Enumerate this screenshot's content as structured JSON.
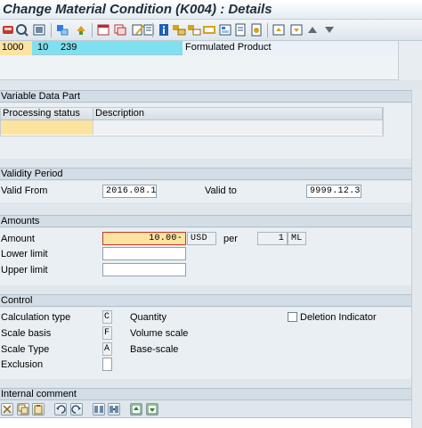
{
  "window": {
    "title": "Change Material Condition (K004) : Details"
  },
  "header_row": {
    "sales_org": "1000",
    "distribution_channel": "10",
    "material": "239",
    "material_description": "Formulated Product"
  },
  "variable_data_part": {
    "section_title": "Variable Data Part",
    "columns": [
      "Processing status",
      "Description"
    ],
    "rows": [
      {
        "processing_status": "",
        "description": ""
      }
    ]
  },
  "validity_period": {
    "section_title": "Validity Period",
    "valid_from_label": "Valid From",
    "valid_from": "2016.08.10",
    "valid_to_label": "Valid to",
    "valid_to": "9999.12.31"
  },
  "amounts": {
    "section_title": "Amounts",
    "amount_label": "Amount",
    "amount_value": "10.00-",
    "currency": "USD",
    "per_label": "per",
    "per_value": "1",
    "unit": "ML",
    "lower_limit_label": "Lower limit",
    "lower_limit_value": "",
    "upper_limit_label": "Upper limit",
    "upper_limit_value": ""
  },
  "control": {
    "section_title": "Control",
    "calculation_type_label": "Calculation type",
    "calculation_type_code": "C",
    "calculation_type_text": "Quantity",
    "scale_basis_label": "Scale basis",
    "scale_basis_code": "F",
    "scale_basis_text": "Volume scale",
    "scale_type_label": "Scale Type",
    "scale_type_code": "A",
    "scale_type_text": "Base-scale",
    "exclusion_label": "Exclusion",
    "exclusion_value": "",
    "deletion_indicator_label": "Deletion Indicator",
    "deletion_indicator_checked": false
  },
  "internal_comment": {
    "section_title": "Internal comment"
  },
  "toolbar_icons": [
    "save-icon",
    "back-icon",
    "overview-icon",
    "key-combination-icon",
    "refresh-icon",
    "condition-records-icon",
    "copy-icon",
    "change-icon",
    "delete-icon",
    "info-icon",
    "scales-icon",
    "supplement-icon",
    "additional-data-icon",
    "first-item-icon",
    "previous-item-icon",
    "next-item-icon",
    "last-item-icon"
  ],
  "comment_toolbar_icons": [
    "cut-icon",
    "copy-icon",
    "paste-icon",
    "undo-icon",
    "redo-icon",
    "find-icon",
    "find-next-icon",
    "upload-icon",
    "download-icon"
  ],
  "colors": {
    "header_cyan": "#7fe0ef",
    "selected_yellow": "#fde3a0",
    "section_bg": "#d2dde6",
    "title_text": "#1f2e3a"
  }
}
